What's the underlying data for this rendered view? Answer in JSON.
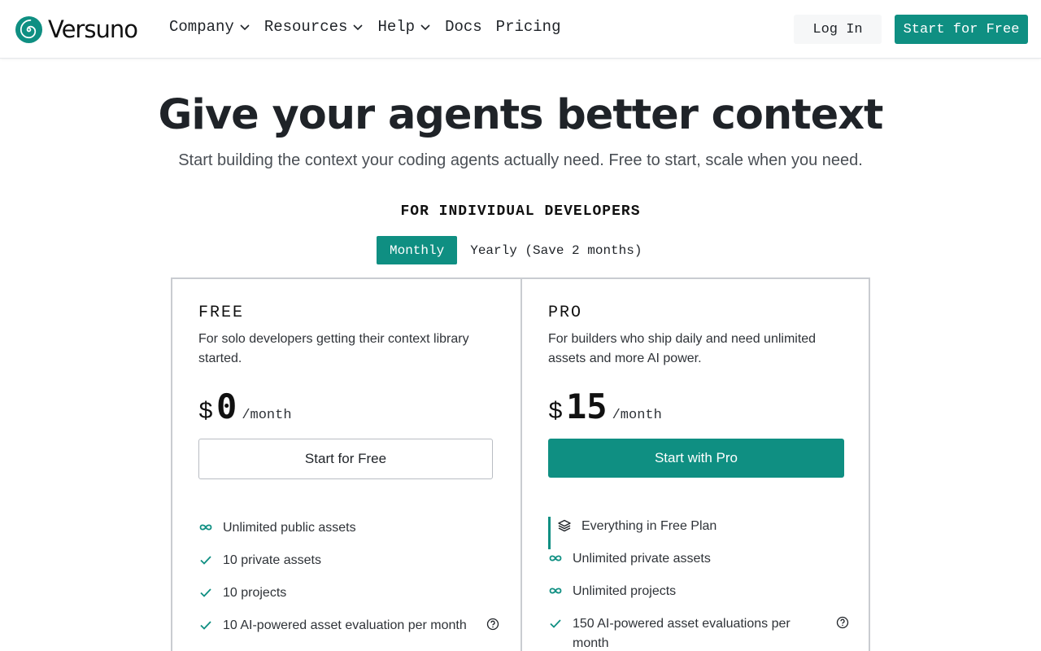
{
  "brand": {
    "name": "Versuno",
    "logo_icon": "spiral-logo-icon",
    "accent": "#0f8f82"
  },
  "nav": {
    "items": [
      {
        "label": "Company",
        "dropdown": true
      },
      {
        "label": "Resources",
        "dropdown": true
      },
      {
        "label": "Help",
        "dropdown": true
      },
      {
        "label": "Docs",
        "dropdown": false
      },
      {
        "label": "Pricing",
        "dropdown": false
      }
    ],
    "login_label": "Log In",
    "start_label": "Start for Free"
  },
  "hero": {
    "title": "Give your agents better context",
    "subtitle": "Start building the context your coding agents actually need. Free to start, scale when you need."
  },
  "section_label": "FOR INDIVIDUAL DEVELOPERS",
  "billing_toggle": {
    "monthly": "Monthly",
    "yearly": "Yearly (Save 2 months)",
    "selected": "Monthly"
  },
  "plans": [
    {
      "name": "FREE",
      "description": "For solo developers getting their context library started.",
      "currency": "$",
      "price": "0",
      "period": "/month",
      "cta": "Start for Free",
      "features": [
        {
          "icon": "infinity-icon",
          "text": "Unlimited public assets",
          "info": false
        },
        {
          "icon": "check-icon",
          "text": "10 private assets",
          "info": false
        },
        {
          "icon": "check-icon",
          "text": "10 projects",
          "info": false
        },
        {
          "icon": "check-icon",
          "text": "10 AI-powered asset evaluation per month",
          "info": true
        }
      ]
    },
    {
      "name": "PRO",
      "description": "For builders who ship daily and need unlimited assets and more AI power.",
      "currency": "$",
      "price": "15",
      "period": "/month",
      "cta": "Start with Pro",
      "features": [
        {
          "icon": "layers-icon",
          "text": "Everything in Free Plan",
          "info": false,
          "highlight": true
        },
        {
          "icon": "infinity-icon",
          "text": "Unlimited private assets",
          "info": false
        },
        {
          "icon": "infinity-icon",
          "text": "Unlimited projects",
          "info": false
        },
        {
          "icon": "check-icon",
          "text": "150 AI-powered asset evaluations per month",
          "info": true
        }
      ]
    }
  ]
}
